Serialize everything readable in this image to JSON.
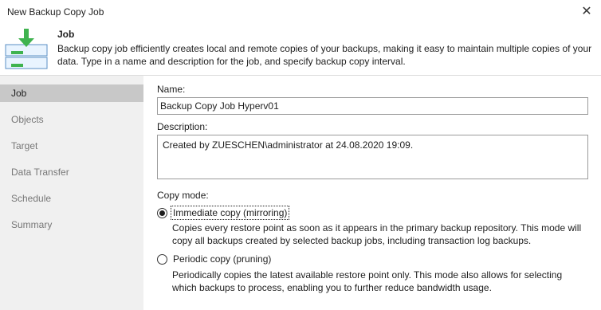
{
  "window": {
    "title": "New Backup Copy Job",
    "close_glyph": "✕"
  },
  "header": {
    "icon": "backup-copy-job-icon",
    "title": "Job",
    "description": "Backup copy job efficiently creates local and remote copies of your backups, making it easy to maintain multiple copies of your data. Type in a name and description for the job, and specify backup copy interval."
  },
  "sidebar": {
    "items": [
      {
        "label": "Job",
        "active": true
      },
      {
        "label": "Objects",
        "active": false
      },
      {
        "label": "Target",
        "active": false
      },
      {
        "label": "Data Transfer",
        "active": false
      },
      {
        "label": "Schedule",
        "active": false
      },
      {
        "label": "Summary",
        "active": false
      }
    ]
  },
  "form": {
    "name_label": "Name:",
    "name_value": "Backup Copy Job Hyperv01",
    "description_label": "Description:",
    "description_value": "Created by ZUESCHEN\\administrator at 24.08.2020 19:09.",
    "copy_mode_label": "Copy mode:",
    "modes": [
      {
        "label": "Immediate copy (mirroring)",
        "selected": true,
        "description": "Copies every restore point as soon as it appears in the primary backup repository. This mode will copy all backups created by selected backup jobs, including transaction log backups."
      },
      {
        "label": "Periodic copy (pruning)",
        "selected": false,
        "description": "Periodically copies the latest available restore point only. This mode also allows for selecting which backups to process, enabling you to further reduce bandwidth usage."
      }
    ]
  },
  "colors": {
    "accent_green": "#3fb34f",
    "sidebar_bg": "#f0f0f0",
    "sidebar_active": "#c8c8c8"
  }
}
